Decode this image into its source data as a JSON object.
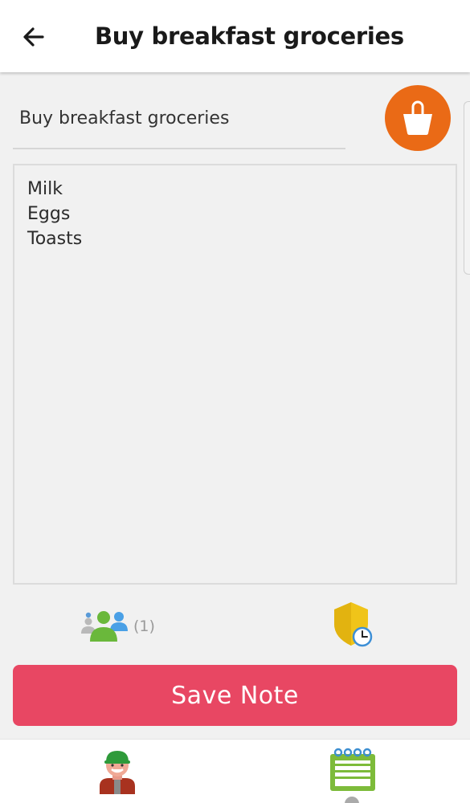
{
  "header": {
    "title": "Buy breakfast groceries",
    "back_icon": "arrow-left-icon"
  },
  "note": {
    "title_value": "Buy breakfast groceries",
    "content_lines": [
      "Milk",
      "Eggs",
      "Toasts"
    ]
  },
  "category": {
    "icon": "shopping-bag-icon",
    "color": "#ea6a16"
  },
  "sharing": {
    "icon": "people-group-icon",
    "count_label": "(1)"
  },
  "privacy": {
    "icon": "shield-clock-icon"
  },
  "actions": {
    "save_label": "Save Note",
    "save_color": "#e84763"
  },
  "bottom_nav": {
    "profile_icon": "avatar-icon",
    "notes_icon": "notepad-icon"
  }
}
